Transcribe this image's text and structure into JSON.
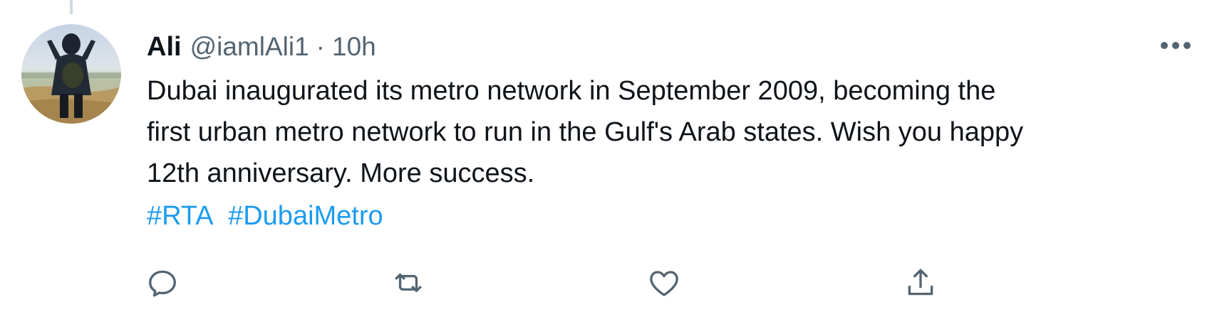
{
  "tweet": {
    "author": {
      "name": "Ali",
      "handle": "@iamlAli1",
      "avatar_icon": "profile-photo"
    },
    "separator": "·",
    "time": "10h",
    "text": "Dubai inaugurated its metro network in September 2009, becoming the\nfirst urban metro network to run in the Gulf's Arab states. Wish you happy\n12th anniversary. More success.",
    "hashtags": [
      "#RTA",
      "#DubaiMetro"
    ]
  },
  "actions": [
    {
      "name": "reply",
      "icon": "reply-icon"
    },
    {
      "name": "retweet",
      "icon": "retweet-icon"
    },
    {
      "name": "like",
      "icon": "heart-icon"
    },
    {
      "name": "share",
      "icon": "share-icon"
    }
  ],
  "colors": {
    "text": "#0f1419",
    "secondary": "#536471",
    "link": "#1d9bf0",
    "thread_line": "#cfd9de"
  }
}
